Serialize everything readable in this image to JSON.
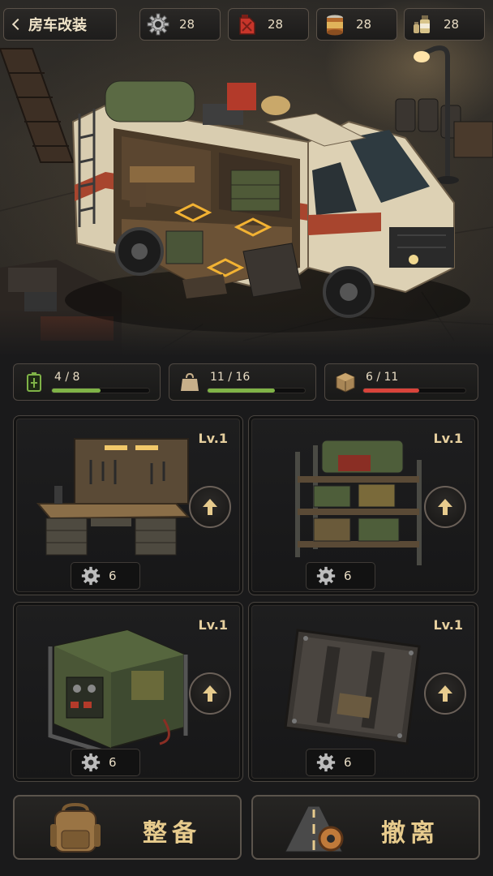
{
  "header": {
    "back_label": "房车改装",
    "resources": [
      {
        "icon": "gear-icon",
        "value": "28"
      },
      {
        "icon": "fuel-can-icon",
        "value": "28"
      },
      {
        "icon": "canned-food-icon",
        "value": "28"
      },
      {
        "icon": "medicine-icon",
        "value": "28"
      }
    ]
  },
  "stats": [
    {
      "icon": "battery-icon",
      "value": "4 / 8",
      "fraction": 0.5,
      "color": "#7fb347"
    },
    {
      "icon": "backpack-weight-icon",
      "value": "11 / 16",
      "fraction": 0.6875,
      "color": "#7fb347"
    },
    {
      "icon": "crate-icon",
      "value": "6 / 11",
      "fraction": 0.545,
      "color": "#d9443b"
    }
  ],
  "modules": [
    {
      "name": "workbench",
      "level": "Lv.1",
      "cost": "6",
      "cost_icon": "gear-icon"
    },
    {
      "name": "storage-shelf",
      "level": "Lv.1",
      "cost": "6",
      "cost_icon": "gear-icon"
    },
    {
      "name": "generator",
      "level": "Lv.1",
      "cost": "6",
      "cost_icon": "gear-icon"
    },
    {
      "name": "armor-plate",
      "level": "Lv.1",
      "cost": "6",
      "cost_icon": "gear-icon"
    }
  ],
  "actions": {
    "prepare_label": "整备",
    "depart_label": "撤离"
  },
  "colors": {
    "accent_gold": "#e7cb8d",
    "bar_green": "#7fb347",
    "bar_red": "#d9443b",
    "highlight": "#f2b233"
  }
}
